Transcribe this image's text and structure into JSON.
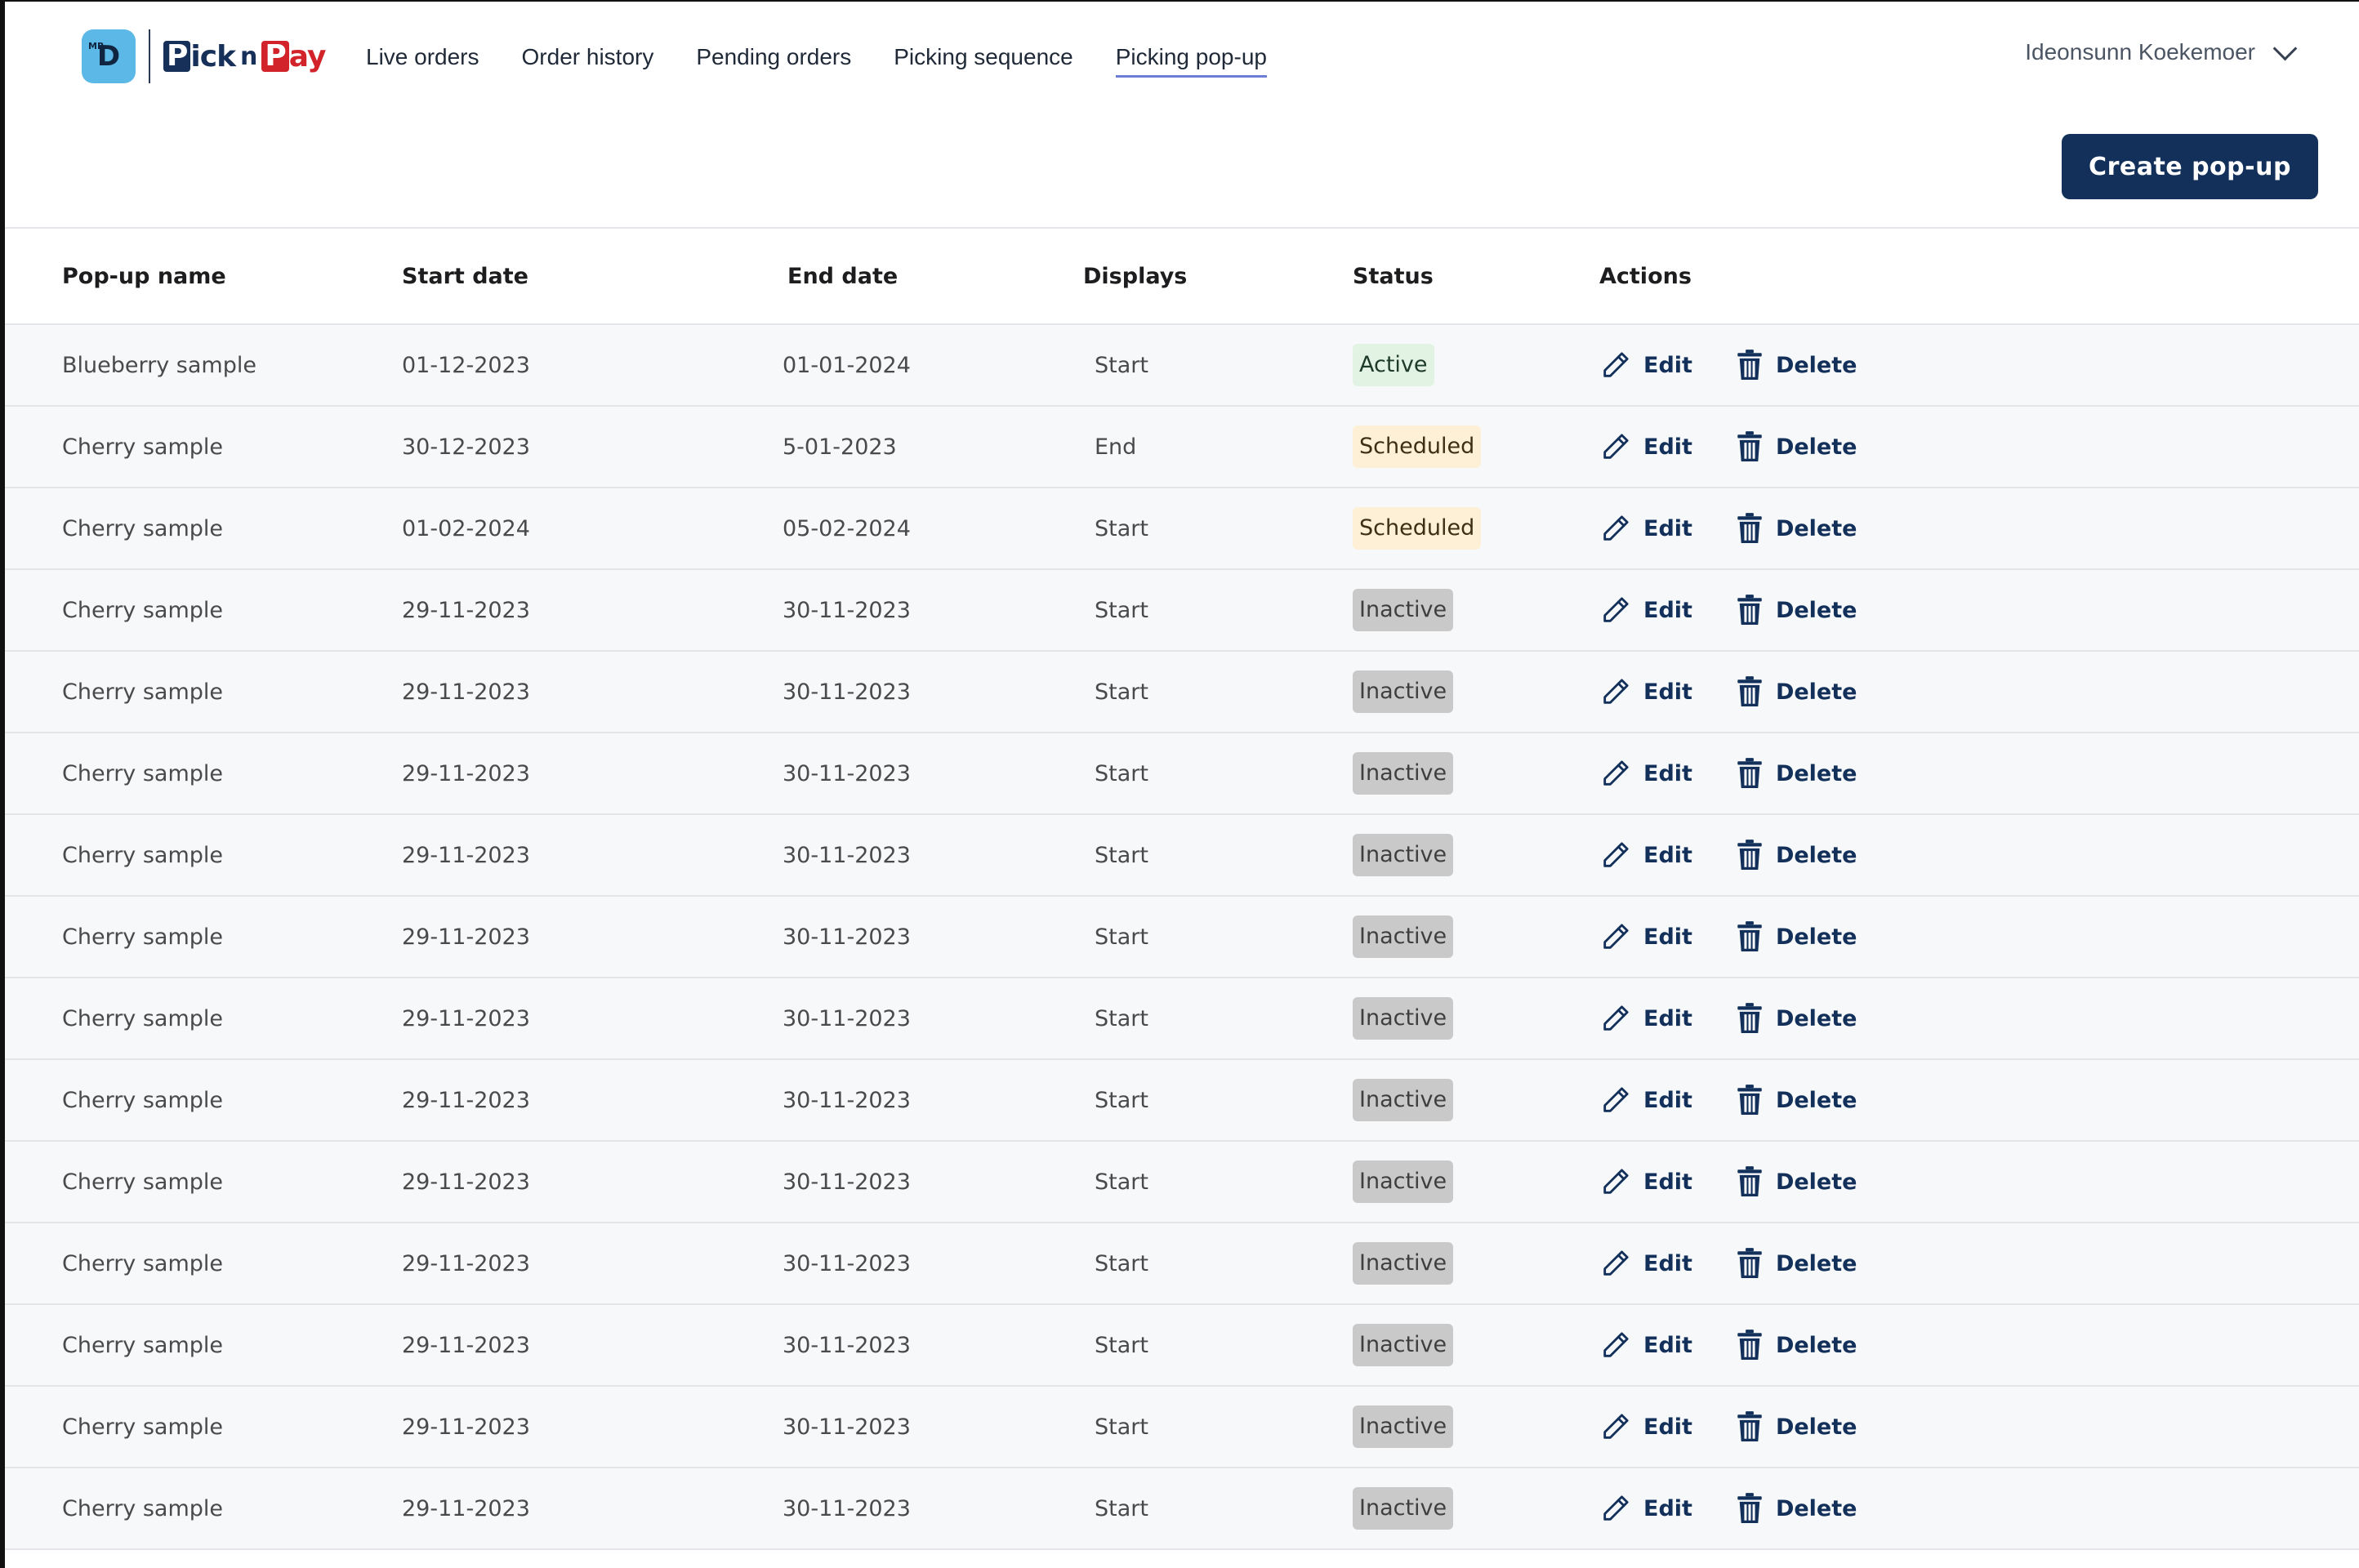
{
  "header": {
    "brand": {
      "mrd_small": "MR",
      "mrd_big": "D",
      "pnp_pick_box": "P",
      "pnp_pick_rest": "ick",
      "pnp_n": "n",
      "pnp_pay_box": "P",
      "pnp_pay_rest": "ay"
    },
    "nav": [
      {
        "label": "Live orders",
        "active": false
      },
      {
        "label": "Order history",
        "active": false
      },
      {
        "label": "Pending orders",
        "active": false
      },
      {
        "label": "Picking sequence",
        "active": false
      },
      {
        "label": "Picking pop-up",
        "active": true
      }
    ],
    "user_name": "Ideonsunn Koekemoer",
    "user_menu_icon": "chevron-down-icon"
  },
  "toolbar": {
    "create_label": "Create pop-up"
  },
  "table": {
    "columns": [
      "Pop-up name",
      "Start date",
      "End date",
      "Displays",
      "Status",
      "Actions"
    ],
    "edit_label": "Edit",
    "delete_label": "Delete",
    "edit_icon": "pencil-icon",
    "delete_icon": "trash-icon",
    "rows": [
      {
        "name": "Blueberry sample",
        "start": "01-12-2023",
        "end": "01-01-2024",
        "displays": "Start",
        "status": "Active"
      },
      {
        "name": "Cherry sample",
        "start": "30-12-2023",
        "end": "5-01-2023",
        "displays": "End",
        "status": "Scheduled"
      },
      {
        "name": "Cherry sample",
        "start": "01-02-2024",
        "end": "05-02-2024",
        "displays": "Start",
        "status": "Scheduled"
      },
      {
        "name": "Cherry sample",
        "start": "29-11-2023",
        "end": "30-11-2023",
        "displays": "Start",
        "status": "Inactive"
      },
      {
        "name": "Cherry sample",
        "start": "29-11-2023",
        "end": "30-11-2023",
        "displays": "Start",
        "status": "Inactive"
      },
      {
        "name": "Cherry sample",
        "start": "29-11-2023",
        "end": "30-11-2023",
        "displays": "Start",
        "status": "Inactive"
      },
      {
        "name": "Cherry sample",
        "start": "29-11-2023",
        "end": "30-11-2023",
        "displays": "Start",
        "status": "Inactive"
      },
      {
        "name": "Cherry sample",
        "start": "29-11-2023",
        "end": "30-11-2023",
        "displays": "Start",
        "status": "Inactive"
      },
      {
        "name": "Cherry sample",
        "start": "29-11-2023",
        "end": "30-11-2023",
        "displays": "Start",
        "status": "Inactive"
      },
      {
        "name": "Cherry sample",
        "start": "29-11-2023",
        "end": "30-11-2023",
        "displays": "Start",
        "status": "Inactive"
      },
      {
        "name": "Cherry sample",
        "start": "29-11-2023",
        "end": "30-11-2023",
        "displays": "Start",
        "status": "Inactive"
      },
      {
        "name": "Cherry sample",
        "start": "29-11-2023",
        "end": "30-11-2023",
        "displays": "Start",
        "status": "Inactive"
      },
      {
        "name": "Cherry sample",
        "start": "29-11-2023",
        "end": "30-11-2023",
        "displays": "Start",
        "status": "Inactive"
      },
      {
        "name": "Cherry sample",
        "start": "29-11-2023",
        "end": "30-11-2023",
        "displays": "Start",
        "status": "Inactive"
      },
      {
        "name": "Cherry sample",
        "start": "29-11-2023",
        "end": "30-11-2023",
        "displays": "Start",
        "status": "Inactive"
      }
    ]
  },
  "colors": {
    "primary": "#12305a",
    "active_badge": "#e3f3e3",
    "scheduled_badge": "#fdf0d6",
    "inactive_badge": "#c9c9c9",
    "row_bg": "#f7f8fa",
    "nav_underline": "#6b7fd6",
    "brand_red": "#d2232a",
    "brand_blue": "#5cb8e6"
  }
}
